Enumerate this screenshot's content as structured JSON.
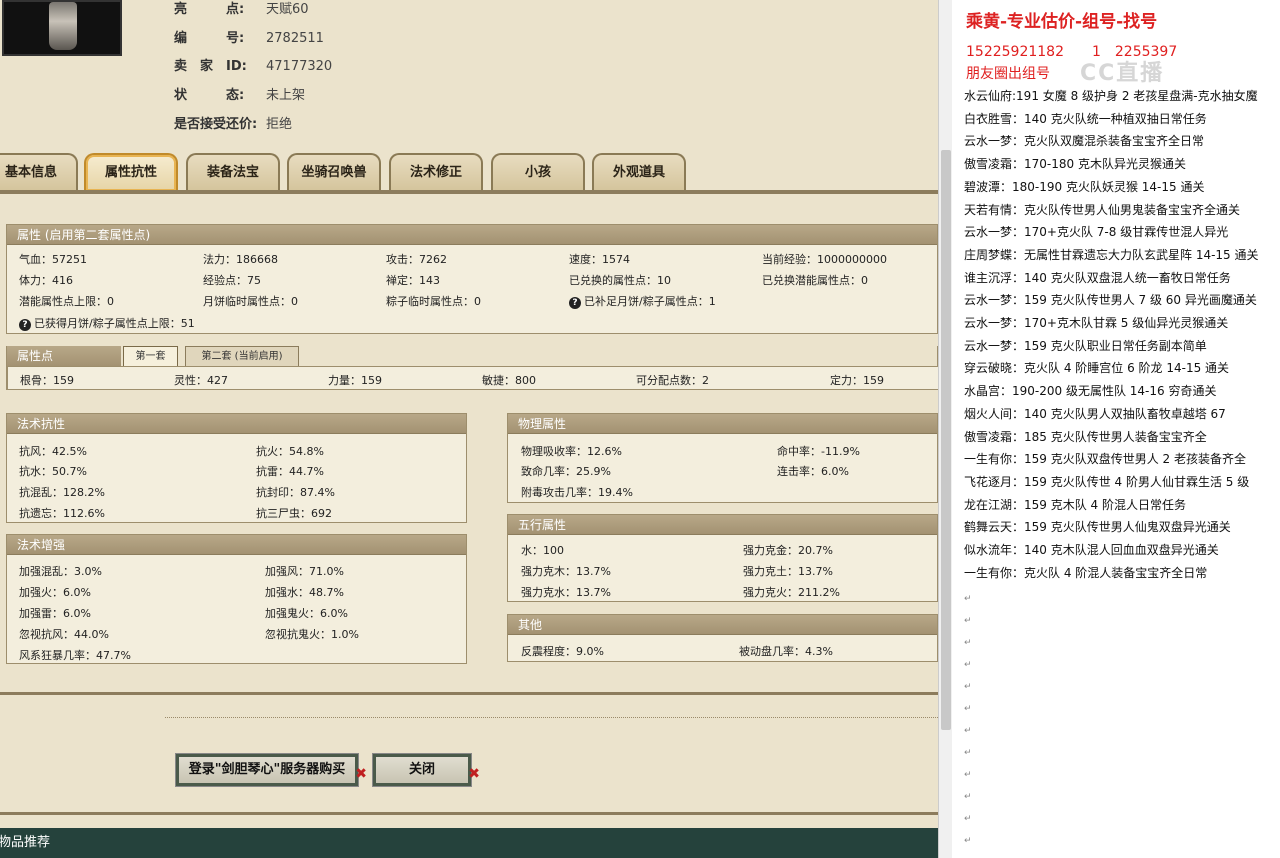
{
  "role_info": [
    {
      "label": "亮　　　点:",
      "value": "天赋60"
    },
    {
      "label": "编　　　号:",
      "value": "2782511"
    },
    {
      "label": "卖　家　ID:",
      "value": "47177320"
    },
    {
      "label": "状　　　态:",
      "value": "未上架"
    },
    {
      "label": "是否接受还价:",
      "value": "拒绝"
    }
  ],
  "tabs": [
    "基本信息",
    "属性抗性",
    "装备法宝",
    "坐骑召唤兽",
    "法术修正",
    "小孩",
    "外观道具"
  ],
  "active_tab": "属性抗性",
  "attr_panel": {
    "title": "属性 (启用第二套属性点)",
    "rows": [
      [
        "气血：57251",
        "法力：186668",
        "攻击：7262",
        "速度：1574",
        "当前经验：1000000000"
      ],
      [
        "体力：416",
        "经验点：75",
        "禅定：143",
        "已兑换的属性点：10",
        "已兑换潜能属性点：0"
      ],
      [
        "潜能属性点上限：0",
        "月饼临时属性点：0",
        "粽子临时属性点：0",
        "已补足月饼/粽子属性点：1"
      ]
    ],
    "note": "已获得月饼/粽子属性点上限：51"
  },
  "points_panel": {
    "title": "属性点",
    "subtabs": [
      "第一套",
      "第二套 (当前启用)"
    ],
    "values": [
      "根骨：159",
      "灵性：427",
      "力量：159",
      "敏捷：800",
      "可分配点数：2",
      "定力：159"
    ]
  },
  "magic_resist": {
    "title": "法术抗性",
    "left": [
      "抗风：42.5%",
      "抗水：50.7%",
      "抗混乱：128.2%",
      "抗遗忘：112.6%"
    ],
    "right": [
      "抗火：54.8%",
      "抗雷：44.7%",
      "抗封印：87.4%",
      "抗三尸虫：692"
    ]
  },
  "magic_boost": {
    "title": "法术增强",
    "left": [
      "加强混乱：3.0%",
      "加强火：6.0%",
      "加强雷：6.0%",
      "忽视抗风：44.0%",
      "风系狂暴几率：47.7%"
    ],
    "right": [
      "加强风：71.0%",
      "加强水：48.7%",
      "加强鬼火：6.0%",
      "忽视抗鬼火：1.0%"
    ]
  },
  "physical": {
    "title": "物理属性",
    "left": [
      "物理吸收率：12.6%",
      "致命几率：25.9%",
      "附毒攻击几率：19.4%"
    ],
    "right": [
      "命中率：-11.9%",
      "连击率：6.0%"
    ]
  },
  "five_elements": {
    "title": "五行属性",
    "left": [
      "水：100",
      "强力克木：13.7%",
      "强力克水：13.7%"
    ],
    "right": [
      "强力克金：20.7%",
      "强力克土：13.7%",
      "强力克火：211.2%"
    ]
  },
  "other": {
    "title": "其他",
    "left": [
      "反震程度：9.0%"
    ],
    "right": [
      "被动盘几率：4.3%"
    ]
  },
  "buttons": {
    "login": "登录\"剑胆琴心\"服务器购买",
    "close": "关闭"
  },
  "bottom_bar": "物品推荐",
  "doc": {
    "heading": "乘黄-专业估价-组号-找号",
    "phone": "15225921182　　1　2255397",
    "sub": "朋友圈出组号",
    "watermark": "CC直播",
    "lines": [
      "水云仙府:191 女魔 8 级护身 2 老孩星盘满-克水抽女魔",
      "白衣胜雪：140 克火队统一种植双抽日常任务",
      "云水一梦：克火队双魔混杀装备宝宝齐全日常",
      "傲雪凌霜：170-180 克木队异光灵猴通关",
      "碧波潭：180-190 克火队妖灵猴 14-15 通关",
      "天若有情：克火队传世男人仙男鬼装备宝宝齐全通关",
      "云水一梦：170+克火队 7-8 级甘霖传世混人异光",
      "庄周梦蝶：无属性甘霖遗忘大力队玄武星阵 14-15 通关",
      "谁主沉浮：140 克火队双盘混人统一畜牧日常任务",
      "云水一梦：159 克火队传世男人 7 级 60 异光画魔通关",
      "云水一梦：170+克木队甘霖 5 级仙异光灵猴通关",
      "云水一梦：159 克火队职业日常任务副本简单",
      "穿云破晓：克火队 4 阶睡宫位 6 阶龙 14-15 通关",
      "水晶宫：190-200 级无属性队 14-16 穷奇通关",
      "烟火人间：140 克火队男人双抽队畜牧卓越塔 67",
      "傲雪凌霜：185 克火队传世男人装备宝宝齐全",
      "一生有你：159 克火队双盘传世男人 2 老孩装备齐全",
      "飞花逐月：159 克火队传世 4 阶男人仙甘霖生活 5 级",
      "龙在江湖：159 克木队 4 阶混人日常任务",
      "鹤舞云天：159 克火队传世男人仙鬼双盘异光通关",
      "似水流年：140 克木队混人回血血双盘异光通关",
      "一生有你：克火队 4 阶混人装备宝宝齐全日常"
    ]
  }
}
